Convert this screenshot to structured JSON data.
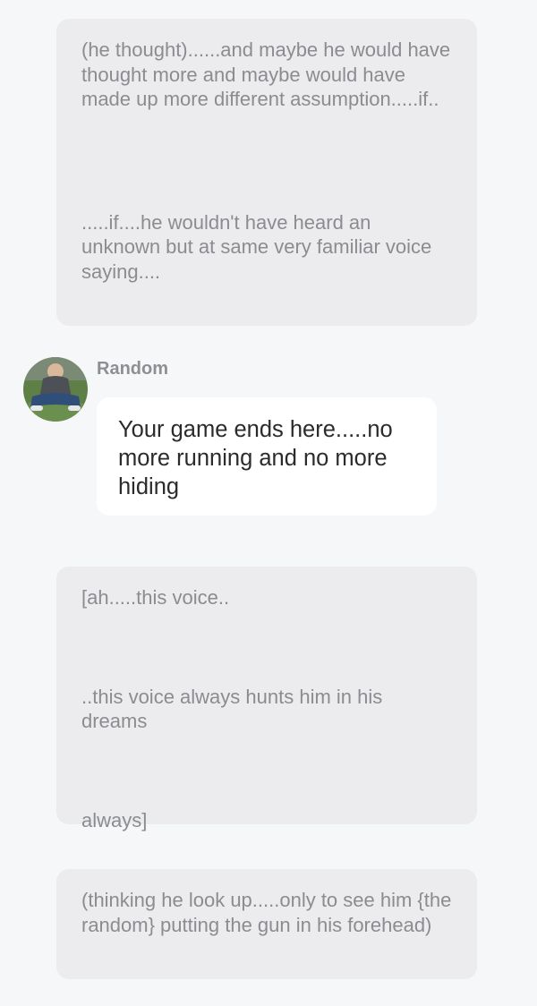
{
  "messages": {
    "narration_1": {
      "part1": "(he thought)......and maybe he would have thought more and maybe would have made up more different assumption.....if..",
      "part2": ".....if....he wouldn't have heard an unknown but at same very familiar voice saying...."
    },
    "character_message": {
      "name": "Random",
      "avatar_icon": "avatar-photo",
      "text": "Your game ends here.....no more running and no more hiding"
    },
    "narration_2": {
      "part1": "[ah.....this voice..",
      "part2": "..this voice always hunts him in his dreams",
      "part3": "always]"
    },
    "narration_3": {
      "text": "(thinking he look up.....only to see him {the random} putting the gun in his forehead)"
    }
  },
  "colors": {
    "background": "#f6f7f9",
    "narration_bubble": "#ececee",
    "narration_text": "#8b8c90",
    "character_bubble": "#ffffff",
    "character_text": "#2b2b2d",
    "speaker_name": "#8e8f93"
  }
}
